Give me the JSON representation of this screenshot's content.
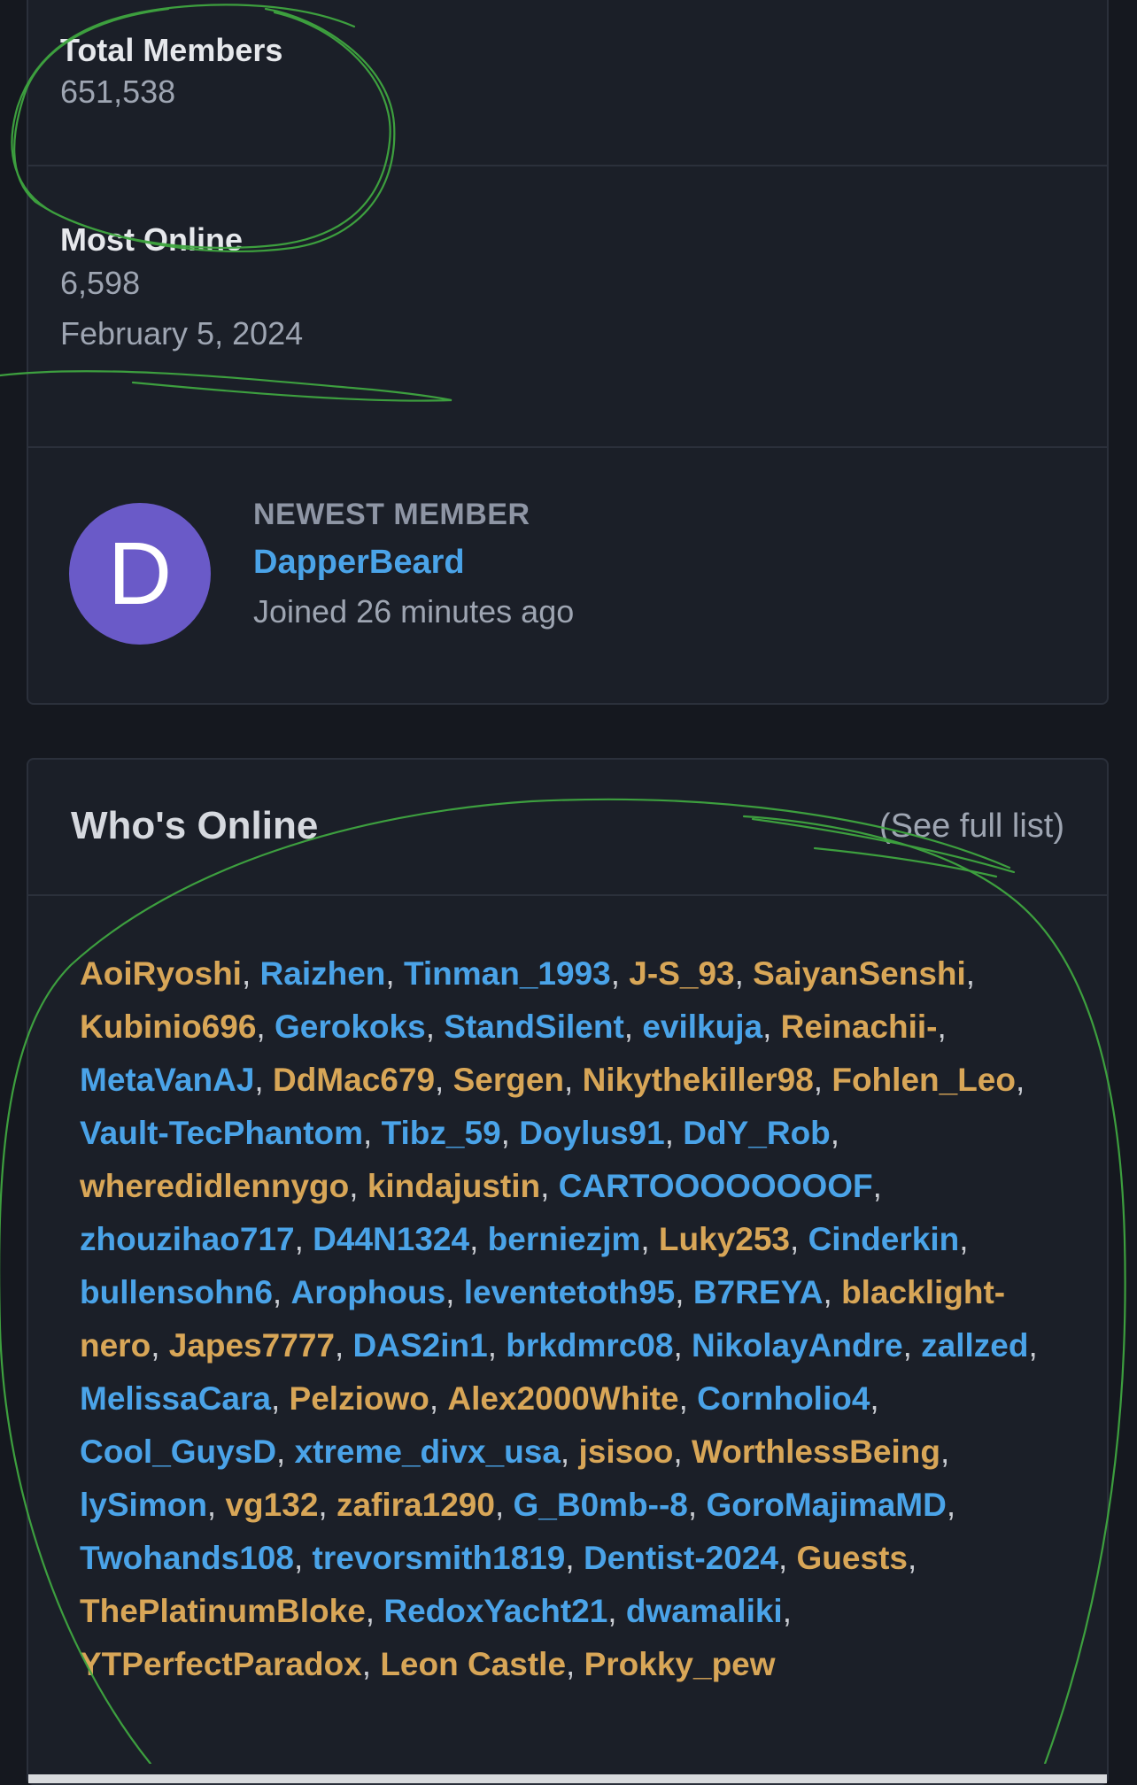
{
  "stats": {
    "total_members_label": "Total Members",
    "total_members_value": "651,538",
    "most_online_label": "Most Online",
    "most_online_value": "6,598",
    "most_online_date": "February 5, 2024"
  },
  "newest_member": {
    "label": "NEWEST MEMBER",
    "avatar_letter": "D",
    "name": "DapperBeard",
    "joined": "Joined 26 minutes ago"
  },
  "whos_online": {
    "title": "Who's Online",
    "see_full_list": "(See full list)",
    "users": [
      {
        "name": "AoiRyoshi",
        "color": "#d8a657"
      },
      {
        "name": "Raizhen",
        "color": "#4aa3e8"
      },
      {
        "name": "Tinman_1993",
        "color": "#4aa3e8"
      },
      {
        "name": "J-S_93",
        "color": "#d8a657"
      },
      {
        "name": "SaiyanSenshi",
        "color": "#d8a657"
      },
      {
        "name": "Kubinio696",
        "color": "#d8a657"
      },
      {
        "name": "Gerokoks",
        "color": "#4aa3e8"
      },
      {
        "name": "StandSilent",
        "color": "#4aa3e8"
      },
      {
        "name": "evilkuja",
        "color": "#4aa3e8"
      },
      {
        "name": "Reinachii-",
        "color": "#d8a657"
      },
      {
        "name": "MetaVanAJ",
        "color": "#4aa3e8"
      },
      {
        "name": "DdMac679",
        "color": "#d8a657"
      },
      {
        "name": "Sergen",
        "color": "#d8a657"
      },
      {
        "name": "Nikythekiller98",
        "color": "#d8a657"
      },
      {
        "name": "Fohlen_Leo",
        "color": "#d8a657"
      },
      {
        "name": "Vault-TecPhantom",
        "color": "#4aa3e8"
      },
      {
        "name": "Tibz_59",
        "color": "#4aa3e8"
      },
      {
        "name": "Doylus91",
        "color": "#4aa3e8"
      },
      {
        "name": "DdY_Rob",
        "color": "#4aa3e8"
      },
      {
        "name": "wheredidlennygo",
        "color": "#d8a657"
      },
      {
        "name": "kindajustin",
        "color": "#d8a657"
      },
      {
        "name": "CARTOOOOOOOOF",
        "color": "#4aa3e8"
      },
      {
        "name": "zhouzihao717",
        "color": "#4aa3e8"
      },
      {
        "name": "D44N1324",
        "color": "#4aa3e8"
      },
      {
        "name": "berniezjm",
        "color": "#4aa3e8"
      },
      {
        "name": "Luky253",
        "color": "#d8a657"
      },
      {
        "name": "Cinderkin",
        "color": "#4aa3e8"
      },
      {
        "name": "bullensohn6",
        "color": "#4aa3e8"
      },
      {
        "name": "Arophous",
        "color": "#4aa3e8"
      },
      {
        "name": "leventetoth95",
        "color": "#4aa3e8"
      },
      {
        "name": "B7REYA",
        "color": "#4aa3e8"
      },
      {
        "name": "blacklight-nero",
        "color": "#d8a657"
      },
      {
        "name": "Japes7777",
        "color": "#d8a657"
      },
      {
        "name": "DAS2in1",
        "color": "#4aa3e8"
      },
      {
        "name": "brkdmrc08",
        "color": "#4aa3e8"
      },
      {
        "name": "NikolayAndre",
        "color": "#4aa3e8"
      },
      {
        "name": "zallzed",
        "color": "#4aa3e8"
      },
      {
        "name": "MelissaCara",
        "color": "#4aa3e8"
      },
      {
        "name": "Pelziowo",
        "color": "#d8a657"
      },
      {
        "name": "Alex2000White",
        "color": "#d8a657"
      },
      {
        "name": "Cornholio4",
        "color": "#4aa3e8"
      },
      {
        "name": "Cool_GuysD",
        "color": "#4aa3e8"
      },
      {
        "name": "xtreme_divx_usa",
        "color": "#4aa3e8"
      },
      {
        "name": "jsisoo",
        "color": "#d8a657"
      },
      {
        "name": "WorthlessBeing",
        "color": "#d8a657"
      },
      {
        "name": "lySimon",
        "color": "#4aa3e8"
      },
      {
        "name": "vg132",
        "color": "#d8a657"
      },
      {
        "name": "zafira1290",
        "color": "#d8a657"
      },
      {
        "name": "G_B0mb--8",
        "color": "#4aa3e8"
      },
      {
        "name": "GoroMajimaMD",
        "color": "#4aa3e8"
      },
      {
        "name": "Twohands108",
        "color": "#4aa3e8"
      },
      {
        "name": "trevorsmith1819",
        "color": "#4aa3e8"
      },
      {
        "name": "Dentist-2024",
        "color": "#4aa3e8"
      },
      {
        "name": "Guests",
        "color": "#d8a657"
      },
      {
        "name": "ThePlatinumBloke",
        "color": "#d8a657"
      },
      {
        "name": "RedoxYacht21",
        "color": "#4aa3e8"
      },
      {
        "name": "dwamaliki",
        "color": "#4aa3e8"
      },
      {
        "name": "YTPerfectParadox",
        "color": "#d8a657"
      },
      {
        "name": "Leon Castle",
        "color": "#d8a657"
      },
      {
        "name": "Prokky_pew",
        "color": "#d8a657"
      }
    ]
  },
  "colors": {
    "background": "#15181f",
    "card": "#1b1f28",
    "link_blue": "#4aa3e8",
    "staff_gold": "#d8a657",
    "avatar": "#6a5ac8",
    "annotation_green": "#3fa640"
  }
}
